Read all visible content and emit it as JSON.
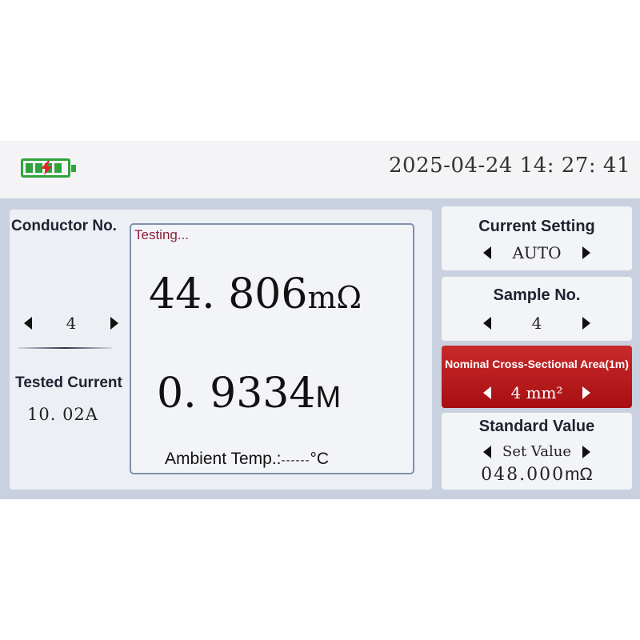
{
  "status_bar": {
    "battery_icon": "battery-charging-icon",
    "datetime": "2025-04-24 14: 27: 41"
  },
  "left": {
    "conductor_title": "Conductor No.",
    "conductor_value": "4",
    "tested_current_title": "Tested Current",
    "tested_current_value": "10. 02A"
  },
  "measurement": {
    "status": "Testing...",
    "resistance_value": "44. 806",
    "resistance_unit": "mΩ",
    "length_value": "0. 9334",
    "length_unit": "M",
    "ambient_label": "Ambient Temp.:",
    "ambient_value": "------",
    "ambient_unit": "°C"
  },
  "settings": {
    "current_title": "Current Setting",
    "current_value": "AUTO",
    "sample_title": "Sample No.",
    "sample_value": "4",
    "area_title": "Nominal Cross-Sectional Area(1m)",
    "area_value": "4 mm²",
    "standard_title": "Standard Value",
    "standard_set_label": "Set Value",
    "standard_value": "048.000",
    "standard_unit": "mΩ"
  },
  "colors": {
    "accent_red": "#b5171c",
    "battery_green": "#2fa43c",
    "status_text": "#8a2038"
  }
}
